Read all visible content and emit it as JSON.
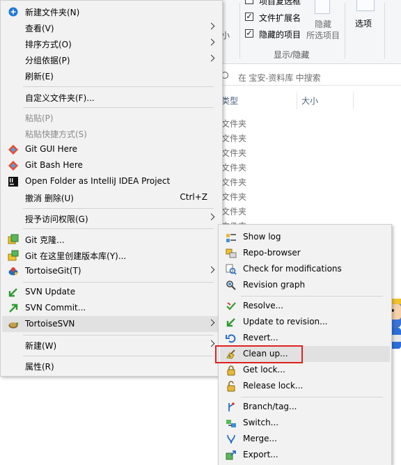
{
  "ribbon": {
    "checkboxes": [
      {
        "label": "项目复选框",
        "checked": false
      },
      {
        "label": "文件扩展名",
        "checked": true
      },
      {
        "label": "隐藏的项目",
        "checked": true
      }
    ],
    "size_partial": "小",
    "hide_label": "隐藏",
    "hide_selected_label": "所选项目",
    "options_label": "选项",
    "group_label": "显示/隐藏"
  },
  "search": {
    "placeholder": "在 宝安-资料库 中搜索"
  },
  "columns": {
    "type": "类型",
    "size": "大小"
  },
  "file_rows": [
    "文件夹",
    "文件夹",
    "文件夹",
    "文件夹",
    "文件夹",
    "文件夹",
    "文件夹",
    "文件夹"
  ],
  "main_menu": {
    "items": [
      {
        "label": "新建文件夹(N)",
        "icon": "new-folder-icon"
      },
      {
        "label": "查看(V)",
        "has_submenu": true
      },
      {
        "label": "排序方式(O)",
        "has_submenu": true
      },
      {
        "label": "分组依据(P)",
        "has_submenu": true
      },
      {
        "label": "刷新(E)"
      },
      {
        "label": "自定义文件夹(F)..."
      },
      {
        "label": "粘贴(P)",
        "disabled": true
      },
      {
        "label": "粘贴快捷方式(S)",
        "disabled": true
      },
      {
        "label": "Git GUI Here",
        "icon": "git-icon"
      },
      {
        "label": "Git Bash Here",
        "icon": "git-icon"
      },
      {
        "label": "Open Folder as IntelliJ IDEA Project",
        "icon": "intellij-icon"
      },
      {
        "label": "撤消 删除(U)",
        "shortcut": "Ctrl+Z"
      },
      {
        "label": "授予访问权限(G)",
        "has_submenu": true
      },
      {
        "label": "Git 克隆...",
        "icon": "git-clone-icon"
      },
      {
        "label": "Git 在这里创建版本库(Y)...",
        "icon": "git-create-repo-icon"
      },
      {
        "label": "TortoiseGit(T)",
        "icon": "tortoisegit-icon",
        "has_submenu": true
      },
      {
        "label": "SVN Update",
        "icon": "svn-update-icon"
      },
      {
        "label": "SVN Commit...",
        "icon": "svn-commit-icon"
      },
      {
        "label": "TortoiseSVN",
        "icon": "tortoisesvn-icon",
        "has_submenu": true,
        "highlighted": true
      },
      {
        "label": "新建(W)",
        "has_submenu": true
      },
      {
        "label": "属性(R)"
      }
    ]
  },
  "svn_submenu": {
    "items": [
      {
        "label": "Show log",
        "icon": "show-log-icon"
      },
      {
        "label": "Repo-browser",
        "icon": "repo-browser-icon"
      },
      {
        "label": "Check for modifications",
        "icon": "check-modifications-icon"
      },
      {
        "label": "Revision graph",
        "icon": "revision-graph-icon"
      },
      {
        "label": "Resolve...",
        "icon": "resolve-icon"
      },
      {
        "label": "Update to revision...",
        "icon": "update-revision-icon"
      },
      {
        "label": "Revert...",
        "icon": "revert-icon"
      },
      {
        "label": "Clean up...",
        "icon": "cleanup-icon",
        "highlighted": true
      },
      {
        "label": "Get lock...",
        "icon": "lock-icon"
      },
      {
        "label": "Release lock...",
        "icon": "unlock-icon"
      },
      {
        "label": "Branch/tag...",
        "icon": "branch-icon"
      },
      {
        "label": "Switch...",
        "icon": "switch-icon"
      },
      {
        "label": "Merge...",
        "icon": "merge-icon"
      },
      {
        "label": "Export...",
        "icon": "export-icon"
      }
    ]
  },
  "colors": {
    "highlight_box": "#e0211f",
    "menu_bg": "#f2f2f2",
    "hover_bg": "#e1e1e1"
  }
}
